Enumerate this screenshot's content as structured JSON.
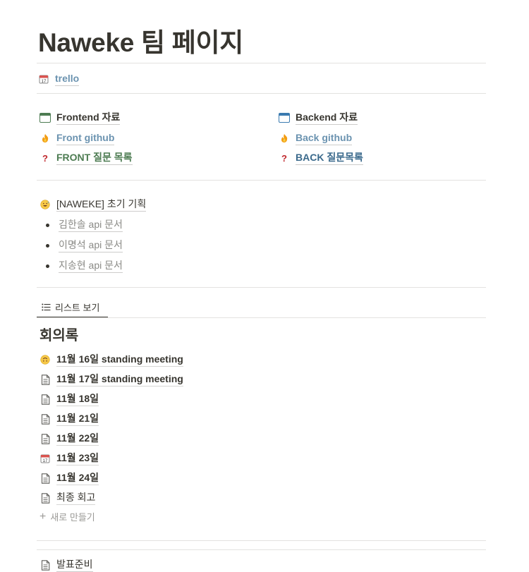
{
  "page": {
    "title": "Naweke 팀 페이지"
  },
  "top_link": {
    "label": "trello",
    "icon": "calendar-icon"
  },
  "left_col": [
    {
      "label": "Frontend 자료",
      "icon": "window-icon",
      "color": "#37352f"
    },
    {
      "label": "Front github",
      "icon": "fire-icon",
      "color": "#6b93b0"
    },
    {
      "label": "FRONT 질문 목록",
      "icon": "question-icon",
      "color": "#4d7c52"
    }
  ],
  "right_col": [
    {
      "label": "Backend 자료",
      "icon": "window-icon",
      "color": "#37352f"
    },
    {
      "label": "Back github",
      "icon": "fire-icon",
      "color": "#6b93b0"
    },
    {
      "label": "BACK 질문목록",
      "icon": "question-icon",
      "color": "#3b6a8c"
    }
  ],
  "planning": {
    "label": "[NAWEKE] 초기 기획",
    "icon": "grinning-sweat-icon",
    "items": [
      "김한솔 api 문서",
      "이명석 api 문서",
      "지송현 api 문서"
    ]
  },
  "database": {
    "view_tab": "리스트 보기",
    "title": "회의록",
    "rows": [
      {
        "label": "11월 16일 standing meeting",
        "icon": "upside-down-face-icon"
      },
      {
        "label": "11월 17일 standing meeting",
        "icon": "page-icon"
      },
      {
        "label": "11월 18일",
        "icon": "page-icon"
      },
      {
        "label": "11월 21일",
        "icon": "page-icon"
      },
      {
        "label": "11월 22일",
        "icon": "page-icon"
      },
      {
        "label": "11월 23일",
        "icon": "calendar-icon"
      },
      {
        "label": "11월 24일",
        "icon": "page-icon"
      },
      {
        "label": "최종 회고",
        "icon": "page-icon"
      }
    ],
    "new_label": "새로 만들기"
  },
  "bottom_page": {
    "label": "발표준비",
    "icon": "page-icon"
  }
}
